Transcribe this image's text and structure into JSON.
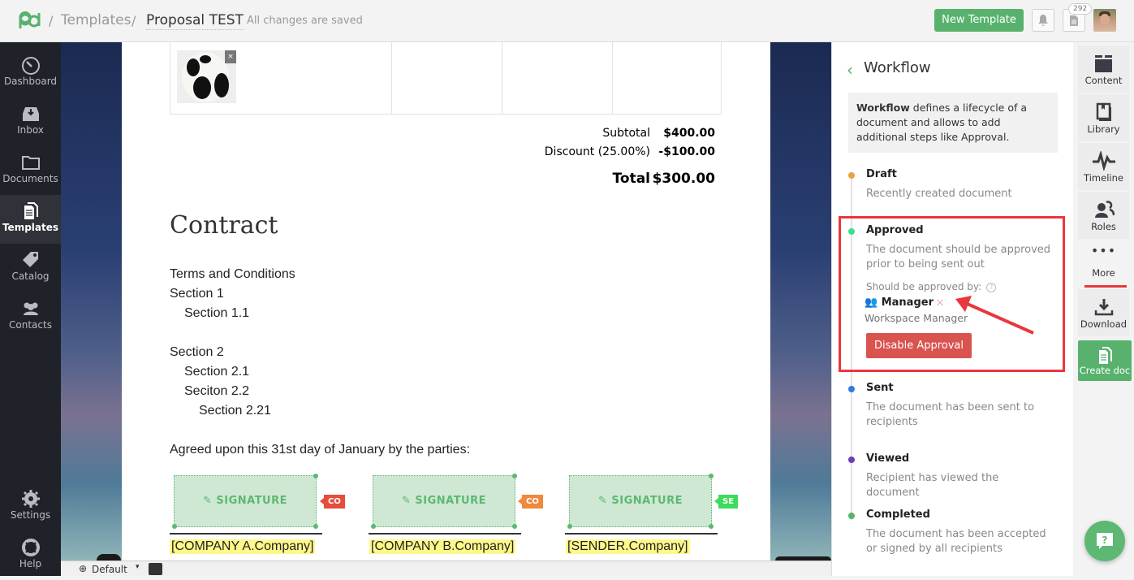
{
  "topbar": {
    "breadcrumb_sep": "/",
    "crumb_templates": "Templates",
    "crumb_title": "Proposal TEST",
    "save_status": "All changes are saved",
    "new_template_label": "New Template",
    "documents_badge": "292",
    "brand_color": "#58b26d"
  },
  "sidebar": {
    "items": [
      {
        "label": "Dashboard",
        "icon": "gauge-icon"
      },
      {
        "label": "Inbox",
        "icon": "inbox-icon"
      },
      {
        "label": "Documents",
        "icon": "folder-icon"
      },
      {
        "label": "Templates",
        "icon": "templates-icon",
        "active": true
      },
      {
        "label": "Catalog",
        "icon": "tag-icon"
      },
      {
        "label": "Contacts",
        "icon": "contacts-icon"
      }
    ],
    "bottom_items": [
      {
        "label": "Settings",
        "icon": "gear-icon"
      },
      {
        "label": "Help",
        "icon": "lifebuoy-icon"
      }
    ]
  },
  "document": {
    "image_remove": "×",
    "totals": {
      "subtotal_label": "Subtotal",
      "subtotal_value": "$400.00",
      "discount_label": "Discount (25.00%)",
      "discount_value": "-$100.00",
      "total_label": "Total",
      "total_value": "$300.00"
    },
    "contract_heading": "Contract",
    "lines": [
      {
        "text": "Terms and Conditions",
        "indent": 0
      },
      {
        "text": "Section 1",
        "indent": 0
      },
      {
        "text": "Section 1.1",
        "indent": 1
      },
      {
        "text": "Section 2",
        "indent": 0
      },
      {
        "text": "Section 2.1",
        "indent": 1
      },
      {
        "text": "Seciton 2.2",
        "indent": 1
      },
      {
        "text": "Section 2.21",
        "indent": 2
      },
      {
        "text": "Agreed upon this 31st day of January by the parties:",
        "indent": 0
      }
    ],
    "signatures": [
      {
        "label": "SIGNATURE",
        "role_tag": "CO",
        "tag_color": "#e74c3c",
        "field": "[COMPANY A.Company]"
      },
      {
        "label": "SIGNATURE",
        "role_tag": "CO",
        "tag_color": "#f0883e",
        "field": "[COMPANY B.Company]"
      },
      {
        "label": "SIGNATURE",
        "role_tag": "SE",
        "tag_color": "#3ddc5a",
        "field": "[SENDER.Company]"
      }
    ]
  },
  "bottombar": {
    "zoom_label": "Default"
  },
  "workflow": {
    "title": "Workflow",
    "info_bold": "Workflow",
    "info_text": " defines a lifecycle of a document and allows to add additional steps like Approval.",
    "steps": [
      {
        "name": "Draft",
        "desc": "Recently created document",
        "color": "#e8a33d"
      },
      {
        "name": "Approved",
        "desc": "The document should be approved prior to being sent out",
        "color": "#3ddc97"
      },
      {
        "name": "Sent",
        "desc": "The document has been sent to recipients",
        "color": "#2f7ae5"
      },
      {
        "name": "Viewed",
        "desc": "Recipient has viewed the document",
        "color": "#6f3bb5"
      },
      {
        "name": "Completed",
        "desc": "The document has been accepted or signed by all recipients",
        "color": "#58b26d"
      }
    ],
    "approval": {
      "label": "Should be approved by:",
      "help": "?",
      "approver_name": "Manager",
      "approver_role": "Workspace Manager",
      "remove": "×",
      "disable_button": "Disable Approval"
    },
    "highlight_color": "#e8383d"
  },
  "rightbar": {
    "items": [
      {
        "label": "Content",
        "icon": "blocks-icon"
      },
      {
        "label": "Library",
        "icon": "book-icon"
      },
      {
        "label": "Timeline",
        "icon": "pulse-icon"
      },
      {
        "label": "Roles",
        "icon": "roles-icon"
      }
    ],
    "more_label": "More",
    "download_label": "Download",
    "create_doc_label": "Create doc"
  },
  "help_fab": {
    "icon": "chat-help-icon",
    "glyph": "?"
  }
}
